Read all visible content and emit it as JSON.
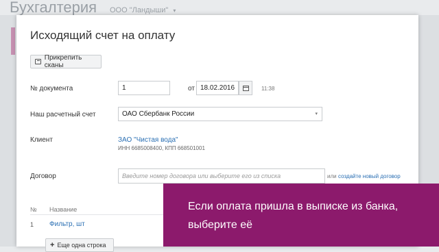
{
  "app": {
    "title": "Бухгалтерия",
    "organization": "ООО \"Ландыши\"",
    "caret": "▾"
  },
  "modal": {
    "title": "Исходящий счет на оплату",
    "attach_button": "Прикрепить сканы",
    "doc_number": {
      "label": "№ документа",
      "value": "1"
    },
    "date": {
      "from_label": "от",
      "value": "18.02.2016",
      "time": "11:38"
    },
    "account": {
      "label": "Наш расчетный счет",
      "value": "ОАО Сбербанк России",
      "caret": "▾"
    },
    "client": {
      "label": "Клиент",
      "name": "ЗАО \"Чистая вода\"",
      "ids": "ИНН 6685008400, КПП 668501001"
    },
    "contract": {
      "label": "Договор",
      "placeholder": "Введите номер договора или выберите его из списка",
      "or_text": "или",
      "create_link": "создайте новый договор"
    },
    "table": {
      "headers": {
        "num": "№",
        "name": "Название"
      },
      "rows": [
        {
          "num": "1",
          "name": "Фильтр, шт"
        }
      ]
    },
    "add_row": {
      "plus": "+",
      "label": "Еще одна строка"
    }
  },
  "caption": {
    "line1": "Если оплата пришла в выписке из банка,",
    "line2": "выберите её"
  }
}
